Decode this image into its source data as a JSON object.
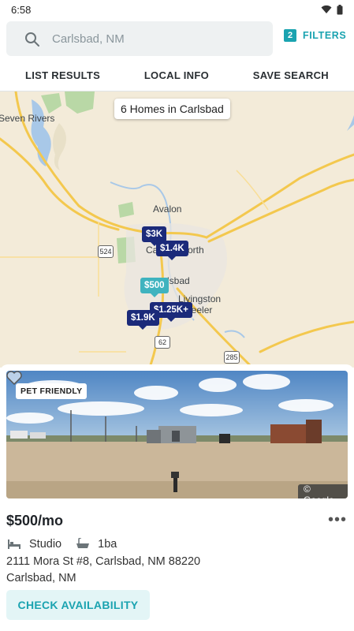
{
  "status_bar": {
    "time": "6:58"
  },
  "search": {
    "placeholder": "Carlsbad, NM"
  },
  "filters": {
    "count": "2",
    "label": "FILTERS"
  },
  "tabs": [
    {
      "label": "LIST RESULTS"
    },
    {
      "label": "LOCAL INFO"
    },
    {
      "label": "SAVE SEARCH"
    }
  ],
  "map": {
    "banner": "6 Homes in Carlsbad",
    "labels": {
      "seven_rivers": "Seven Rivers",
      "avalon": "Avalon",
      "carlsbad_partial": "Ca",
      "north_partial": "orth",
      "lsbad_partial": "lsbad",
      "livingston": "Livingston",
      "wheeler_partial": "heeler"
    },
    "shields": {
      "r524": "524",
      "us62": "62",
      "us285": "285"
    },
    "pins": [
      {
        "label": "$3K",
        "style": "navy"
      },
      {
        "label": "$1.4K",
        "style": "navy"
      },
      {
        "label": "$500",
        "style": "teal"
      },
      {
        "label": "$1.25K+",
        "style": "navy"
      },
      {
        "label": "$1.9K",
        "style": "navy"
      }
    ]
  },
  "listing": {
    "badge": "PET FRIENDLY",
    "photo_credit": "© Google",
    "price": "$500/mo",
    "more_menu": "•••",
    "beds": "Studio",
    "baths": "1ba",
    "address_line1": "2111 Mora St  #8, Carlsbad, NM 88220",
    "address_line2": "Carlsbad, NM",
    "cta": "CHECK AVAILABILITY"
  },
  "colors": {
    "accent": "#1aa3b0",
    "pin_navy": "#1b2a7a",
    "pin_teal": "#3fb3bf",
    "map_bg": "#f3ebd9",
    "water": "#a8c8e8",
    "road": "#f3c84e"
  }
}
